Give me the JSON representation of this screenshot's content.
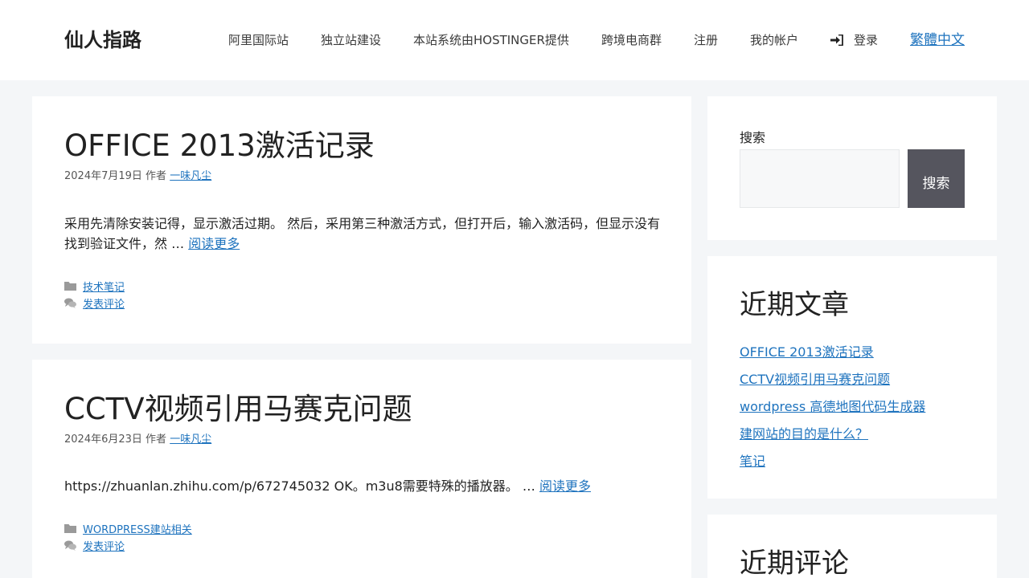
{
  "site": {
    "title": "仙人指路"
  },
  "nav": {
    "items": [
      "阿里国际站",
      "独立站建设",
      "本站系统由HOSTINGER提供",
      "跨境电商群",
      "注册",
      "我的帐户"
    ],
    "login_label": "登录",
    "lang_label": "繁體中文",
    "login_icon": "sign-in-icon"
  },
  "posts": [
    {
      "title": "OFFICE 2013激活记录",
      "date": "2024年7月19日",
      "author_prefix": "作者",
      "author": "一味凡尘",
      "excerpt": "采用先清除安装记得，显示激活过期。 然后，采用第三种激活方式，但打开后，输入激活码，但显示没有找到验证文件，然 …",
      "read_more": "阅读更多",
      "category": "技术笔记",
      "comment": "发表评论"
    },
    {
      "title": "CCTV视频引用马赛克问题",
      "date": "2024年6月23日",
      "author_prefix": "作者",
      "author": "一味凡尘",
      "excerpt": "https://zhuanlan.zhihu.com/p/672745032 OK。m3u8需要特殊的播放器。 …",
      "read_more": "阅读更多",
      "category": "WORDPRESS建站相关",
      "comment": "发表评论"
    }
  ],
  "sidebar": {
    "search": {
      "label": "搜索",
      "button": "搜索",
      "value": ""
    },
    "recent_posts": {
      "title": "近期文章",
      "items": [
        "OFFICE 2013激活记录",
        "CCTV视频引用马赛克问题",
        "wordpress 高德地图代码生成器",
        "建网站的目的是什么？",
        "笔记"
      ]
    },
    "recent_comments": {
      "title": "近期评论"
    }
  }
}
